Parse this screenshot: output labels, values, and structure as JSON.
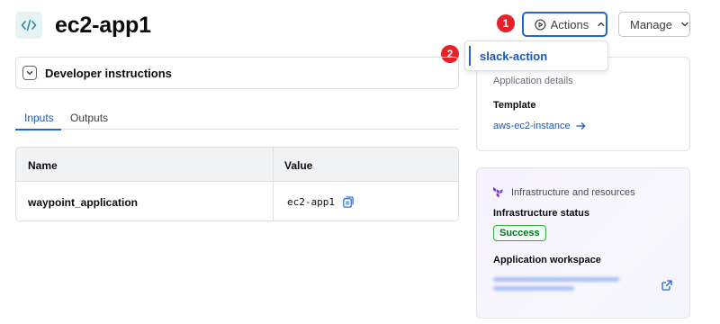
{
  "header": {
    "title": "ec2-app1",
    "actions_label": "Actions",
    "manage_label": "Manage"
  },
  "annotations": [
    "1",
    "2"
  ],
  "actions_menu": {
    "items": [
      {
        "label": "slack-action"
      }
    ]
  },
  "developer_panel": {
    "label": "Developer instructions"
  },
  "tabs": [
    {
      "label": "Inputs",
      "active": true
    },
    {
      "label": "Outputs",
      "active": false
    }
  ],
  "table": {
    "columns": [
      "Name",
      "Value"
    ],
    "rows": [
      {
        "name": "waypoint_application",
        "value": "ec2-app1"
      }
    ]
  },
  "details_card": {
    "heading": "Application details",
    "template_label": "Template",
    "template_value": "aws-ec2-instance"
  },
  "infra_card": {
    "heading": "Infrastructure and resources",
    "status_label": "Infrastructure status",
    "status_value": "Success",
    "workspace_label": "Application workspace"
  },
  "colors": {
    "accent": "#2264d6",
    "link": "#1b55b8",
    "badge": "#e52228",
    "success": "#00781e",
    "terraform": "#7b42bc"
  },
  "icons": [
    "code-icon",
    "play-circle-icon",
    "chevron-up-icon",
    "chevron-down-icon",
    "copy-icon",
    "arrow-right-icon",
    "terraform-icon",
    "external-link-icon"
  ]
}
